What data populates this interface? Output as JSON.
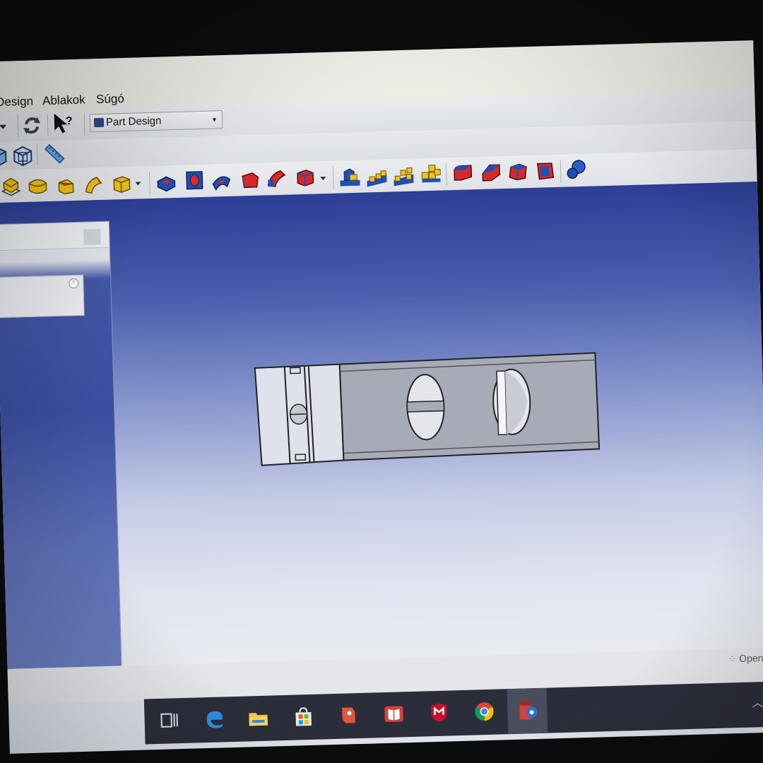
{
  "menu": {
    "items": [
      "Design",
      "Ablakok",
      "Súgó"
    ]
  },
  "toolbar": {
    "workbench_selector": "Part Design",
    "main_icons": [
      "dropdown-arrow-icon",
      "refresh-icon",
      "whats-this-icon"
    ],
    "view_icons": [
      "view-iso-icon",
      "view-wireframe-icon",
      "measure-icon"
    ],
    "part_design_icons": [
      "pad-icon",
      "revolution-icon",
      "additive-loft-icon",
      "additive-pipe-icon",
      "additive-box-icon",
      "pocket-icon",
      "hole-icon",
      "groove-icon",
      "subtractive-loft-icon",
      "subtractive-pipe-icon",
      "subtractive-box-icon",
      "mirrored-icon",
      "linear-pattern-icon",
      "polar-pattern-icon",
      "multitransform-icon",
      "fillet-icon",
      "chamfer-icon",
      "draft-icon",
      "thickness-icon",
      "boolean-icon"
    ]
  },
  "combo_view": {
    "collapse_icon": "collapse-up-icon"
  },
  "status": {
    "renderer_label": "OpenC"
  },
  "taskbar": {
    "icons": [
      "task-view-icon",
      "edge-icon",
      "file-explorer-icon",
      "store-icon",
      "app-red-icon",
      "app-book-icon",
      "mcafee-icon",
      "chrome-icon",
      "freecad-icon"
    ]
  },
  "colors": {
    "viewport_top": "#2c3e96",
    "viewport_bottom": "#e8eaf0",
    "icon_blue": "#1f4fb5",
    "icon_red": "#d42a2a",
    "icon_yellow": "#f0c419",
    "taskbar": "#2b2d3a"
  }
}
